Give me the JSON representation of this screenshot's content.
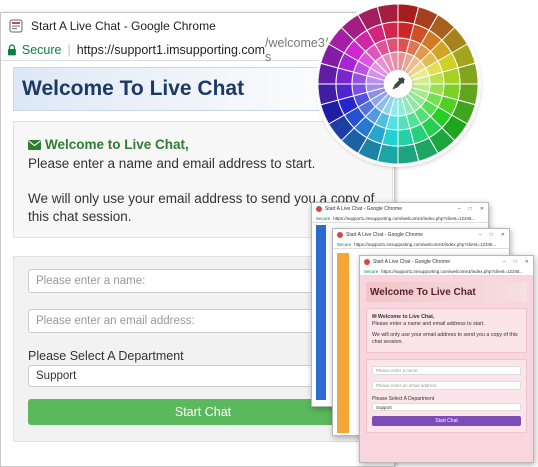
{
  "main_window": {
    "title": "Start A Live Chat - Google Chrome",
    "controls": {
      "minimize": "–",
      "maximize": "□",
      "close": "✕"
    },
    "address": {
      "secure_label": "Secure",
      "separator": "|",
      "host": "https://support1.imsupporting.com",
      "path": "/welcome3/index.php?s"
    },
    "banner_title": "Welcome To Live Chat",
    "info": {
      "welcome": "Welcome to Live Chat,",
      "line1": "Please enter a name and email address to start.",
      "line2": "We will only use your email address to send you a copy of this chat session."
    },
    "form": {
      "name_placeholder": "Please enter a name:",
      "email_placeholder": "Please enter an email address:",
      "department_label": "Please Select A Department",
      "department_selected": "Support",
      "start_button": "Start Chat"
    },
    "colors": {
      "accent_green": "#5cb85c",
      "welcome_green": "#2e7d32",
      "banner_text": "#1c3a63"
    }
  },
  "thumbnails": [
    {
      "title": "Start A Live Chat - Google Chrome",
      "secure": "Secure",
      "url": "https://support1.imsupporting.com/welcome3/index.php?client=12345...",
      "accent": "#2b6bd0"
    },
    {
      "title": "Start A Live Chat - Google Chrome",
      "secure": "Secure",
      "url": "https://support1.imsupporting.com/welcome3/index.php?client=12345...",
      "accent": "#f3a535"
    },
    {
      "title": "Start A Live Chat - Google Chrome",
      "secure": "Secure",
      "url": "https://support1.imsupporting.com/welcome3/index.php?client=12345...",
      "banner_title": "Welcome To Live Chat",
      "welcome": "Welcome to Live Chat,",
      "line1": "Please enter a name and email address to start.",
      "line2": "We will only use your email address to send you a copy of this chat session.",
      "name_placeholder": "Please enter a name",
      "email_placeholder": "Please enter an email address",
      "department_label": "Please Select A Department",
      "department_selected": "Support",
      "start_button": "Start Chat",
      "accent": "#7c4cb8"
    }
  ],
  "color_wheel": {
    "icon": "eyedropper-icon"
  }
}
